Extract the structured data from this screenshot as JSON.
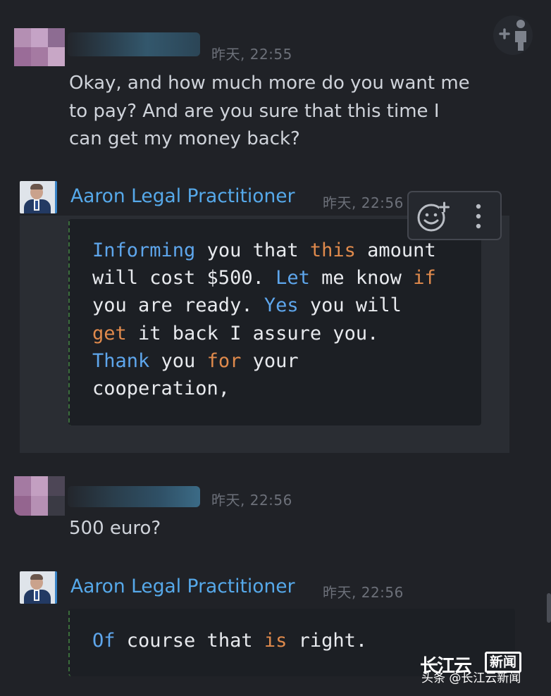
{
  "messages": [
    {
      "time": "昨天, 22:55",
      "text": [
        "Okay, and how much more do you want me",
        "to pay? And are you sure that this time I",
        "can get my money back?"
      ]
    },
    {
      "sender": "Aaron Legal Practitioner",
      "time": "昨天, 22:56",
      "code": [
        [
          {
            "t": "Informing",
            "c": "blue"
          },
          {
            "t": " you that "
          },
          {
            "t": "this",
            "c": "orange"
          },
          {
            "t": " amount"
          }
        ],
        [
          {
            "t": "will cost $500. "
          },
          {
            "t": "Let",
            "c": "blue"
          },
          {
            "t": " me know "
          },
          {
            "t": "if",
            "c": "orange"
          }
        ],
        [
          {
            "t": "you are ready. "
          },
          {
            "t": "Yes",
            "c": "blue"
          },
          {
            "t": " you will"
          }
        ],
        [
          {
            "t": "get",
            "c": "orange"
          },
          {
            "t": " it back I assure you."
          }
        ],
        [
          {
            "t": "Thank",
            "c": "blue"
          },
          {
            "t": " you "
          },
          {
            "t": "for",
            "c": "orange"
          },
          {
            "t": " your"
          }
        ],
        [
          {
            "t": "cooperation,"
          }
        ]
      ]
    },
    {
      "time": "昨天, 22:56",
      "text": [
        "500 euro?"
      ]
    },
    {
      "sender": "Aaron Legal Practitioner",
      "time": "昨天, 22:56",
      "code": [
        [
          {
            "t": "Of",
            "c": "blue"
          },
          {
            "t": " course that "
          },
          {
            "t": "is",
            "c": "orange"
          },
          {
            "t": " right."
          }
        ]
      ]
    }
  ],
  "colors": {
    "background": "#202227",
    "sender_name": "#56a9ea",
    "keyword_blue": "#5ea6ec",
    "keyword_orange": "#e08a4c"
  },
  "icons": [
    "add-friend-icon",
    "add-reaction-icon",
    "more-options-icon"
  ],
  "watermark": {
    "logo": "长江云",
    "box": "新闻",
    "text": "头条 @长江云新闻"
  }
}
